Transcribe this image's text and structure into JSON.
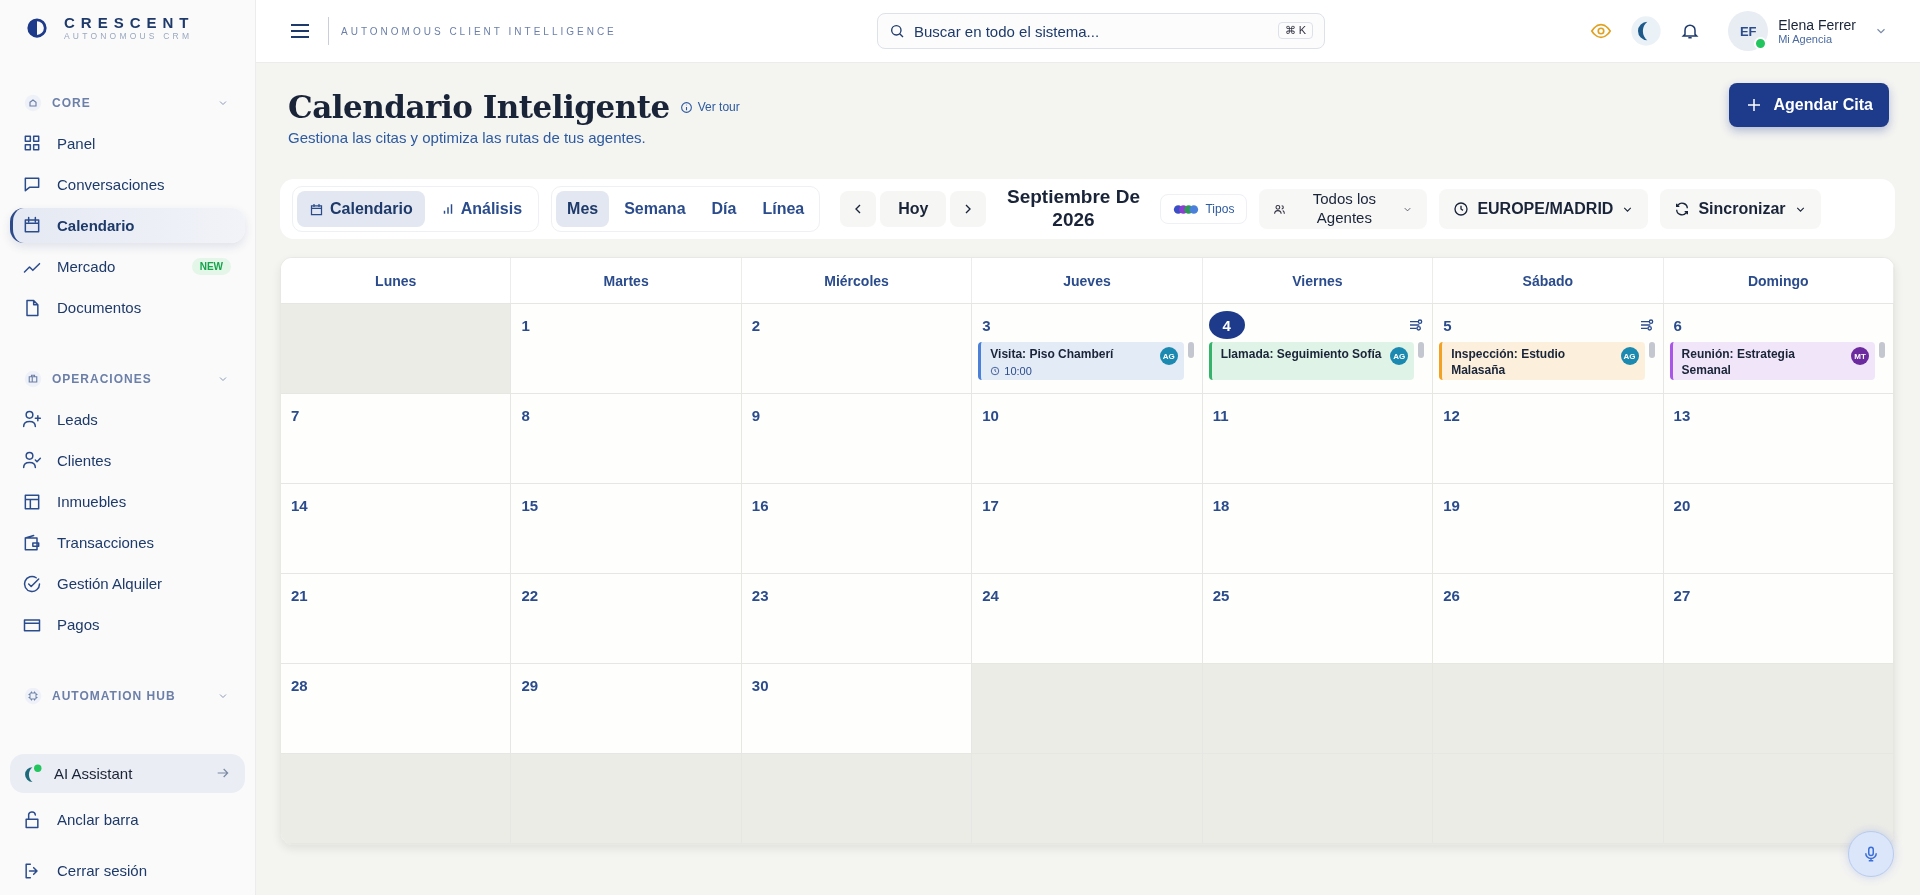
{
  "brand": {
    "name": "CRESCENT",
    "tagline": "AUTONOMOUS CRM"
  },
  "sidebar": {
    "sections": [
      {
        "title": "CORE",
        "expanded": true,
        "items": [
          {
            "label": "Panel",
            "selected": false
          },
          {
            "label": "Conversaciones",
            "selected": false
          },
          {
            "label": "Calendario",
            "selected": true
          },
          {
            "label": "Mercado",
            "selected": false,
            "badge": "NEW"
          },
          {
            "label": "Documentos",
            "selected": false
          }
        ]
      },
      {
        "title": "OPERACIONES",
        "expanded": true,
        "items": [
          {
            "label": "Leads",
            "selected": false
          },
          {
            "label": "Clientes",
            "selected": false
          },
          {
            "label": "Inmuebles",
            "selected": false
          },
          {
            "label": "Transacciones",
            "selected": false
          },
          {
            "label": "Gestión Alquiler",
            "selected": false
          },
          {
            "label": "Pagos",
            "selected": false
          }
        ]
      },
      {
        "title": "AUTOMATION HUB",
        "expanded": true
      }
    ],
    "assistant": {
      "label": "AI Assistant",
      "online": true
    },
    "footer": [
      "Anclar barra",
      "Cerrar sesión"
    ]
  },
  "topbar": {
    "tagline": "AUTONOMOUS CLIENT INTELLIGENCE",
    "search": {
      "placeholder": "Buscar en todo el sistema...",
      "shortcut": "⌘ K"
    },
    "user": {
      "initials": "EF",
      "name": "Elena Ferrer",
      "org": "Mi Agencia",
      "online": true
    }
  },
  "page": {
    "title": "Calendario Inteligente",
    "tour_link": "Ver tour",
    "subtitle": "Gestiona las citas y optimiza las rutas de tus agentes.",
    "primary_button": "Agendar Cita"
  },
  "toolbar": {
    "view_tabs": [
      {
        "label": "Calendario",
        "selected": true
      },
      {
        "label": "Análisis",
        "selected": false
      }
    ],
    "range_tabs": [
      {
        "label": "Mes",
        "selected": true
      },
      {
        "label": "Semana",
        "selected": false
      },
      {
        "label": "Día",
        "selected": false
      },
      {
        "label": "Línea",
        "selected": false
      }
    ],
    "today": "Hoy",
    "period": "Septiembre De 2026",
    "types": "Tipos",
    "agents": "Todos los Agentes",
    "timezone": "EUROPE/MADRID",
    "sync": "Sincronizar"
  },
  "calendar": {
    "weekdays": [
      "Lunes",
      "Martes",
      "Miércoles",
      "Jueves",
      "Viernes",
      "Sábado",
      "Domingo"
    ],
    "weeks": [
      [
        {
          "in_month": false
        },
        {
          "in_month": true,
          "day": "1"
        },
        {
          "in_month": true,
          "day": "2"
        },
        {
          "in_month": true,
          "day": "3",
          "events": [
            {
              "title": "Visita: Piso Chamberí",
              "time": "10:00",
              "color": "#4a80d9",
              "agent": {
                "initials": "AG",
                "color": "#1c8ab0"
              }
            }
          ]
        },
        {
          "in_month": true,
          "day": "4",
          "today": true,
          "filter": true,
          "events": [
            {
              "title": "Llamada: Seguimiento Sofía",
              "color": "#35b36a",
              "agent": {
                "initials": "AG",
                "color": "#1c8ab0"
              }
            }
          ]
        },
        {
          "in_month": true,
          "day": "5",
          "filter": true,
          "events": [
            {
              "title": "Inspección: Estudio Malasaña",
              "color": "#f2a122",
              "agent": {
                "initials": "AG",
                "color": "#1c8ab0"
              }
            }
          ]
        },
        {
          "in_month": true,
          "day": "6",
          "events": [
            {
              "title": "Reunión: Estrategia Semanal",
              "color": "#a855e8",
              "agent": {
                "initials": "MT",
                "color": "#6b2a9e"
              }
            }
          ]
        }
      ],
      [
        {
          "in_month": true,
          "day": "7"
        },
        {
          "in_month": true,
          "day": "8"
        },
        {
          "in_month": true,
          "day": "9"
        },
        {
          "in_month": true,
          "day": "10"
        },
        {
          "in_month": true,
          "day": "11"
        },
        {
          "in_month": true,
          "day": "12"
        },
        {
          "in_month": true,
          "day": "13"
        }
      ],
      [
        {
          "in_month": true,
          "day": "14"
        },
        {
          "in_month": true,
          "day": "15"
        },
        {
          "in_month": true,
          "day": "16"
        },
        {
          "in_month": true,
          "day": "17"
        },
        {
          "in_month": true,
          "day": "18"
        },
        {
          "in_month": true,
          "day": "19"
        },
        {
          "in_month": true,
          "day": "20"
        }
      ],
      [
        {
          "in_month": true,
          "day": "21"
        },
        {
          "in_month": true,
          "day": "22"
        },
        {
          "in_month": true,
          "day": "23"
        },
        {
          "in_month": true,
          "day": "24"
        },
        {
          "in_month": true,
          "day": "25"
        },
        {
          "in_month": true,
          "day": "26"
        },
        {
          "in_month": true,
          "day": "27"
        }
      ],
      [
        {
          "in_month": true,
          "day": "28"
        },
        {
          "in_month": true,
          "day": "29"
        },
        {
          "in_month": true,
          "day": "30"
        },
        {
          "in_month": false
        },
        {
          "in_month": false
        },
        {
          "in_month": false
        },
        {
          "in_month": false
        }
      ],
      [
        {
          "in_month": false
        },
        {
          "in_month": false
        },
        {
          "in_month": false
        },
        {
          "in_month": false
        },
        {
          "in_month": false
        },
        {
          "in_month": false
        },
        {
          "in_month": false
        }
      ]
    ]
  }
}
